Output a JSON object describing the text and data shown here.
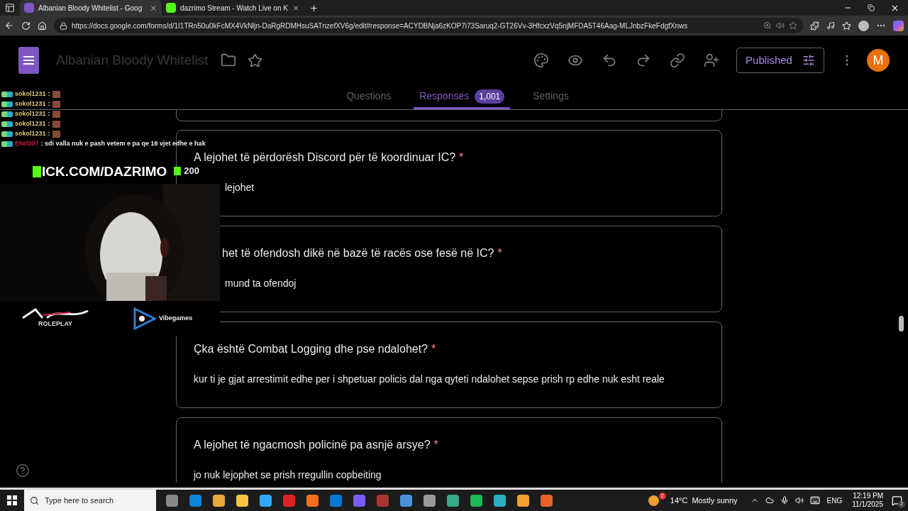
{
  "browser": {
    "tabs": [
      {
        "title": "Albanian Bloody Whitelist - Goog",
        "selected": true,
        "kind": "forms"
      },
      {
        "title": "dazrimo Stream - Watch Live on K",
        "selected": false,
        "kind": "kick"
      }
    ],
    "url": "https://docs.google.com/forms/d/1I1TRn50u0kFcMX4VkNljn-DaRgRDMHsuSATnzefXV6g/edit#response=ACYDBNja6zKOP7i73Saruq2-GT26Vv-3HfcxzVq5njMFDA5T46Aag-MLJnbzFkeFdgfXnws"
  },
  "form": {
    "title": "Albanian Bloody Whitelist",
    "publish_label": "Published",
    "avatar": "M",
    "tabs": [
      {
        "label": "Questions",
        "selected": false
      },
      {
        "label": "Responses",
        "selected": true,
        "badge": "1,001"
      },
      {
        "label": "Settings",
        "selected": false
      }
    ]
  },
  "cards": [
    {
      "question": "A lejohet të përdorësh Discord për të koordinuar IC?",
      "required_mark": "*",
      "answer": "lejohet"
    },
    {
      "question": "het të ofendosh dikë në bazë të racës ose fesë në IC?",
      "required_mark": "*",
      "answer": "mund ta ofendoj"
    },
    {
      "question": "Çka është Combat Logging dhe pse ndalohet?",
      "required_mark": "*",
      "answer": "kur ti je gjat arrestimit edhe per i shpetuar policis dal nga qyteti ndalohet sepse prish rp edhe nuk esht reale"
    },
    {
      "question": "A lejohet të ngacmosh policinë pa asnjë arsye?",
      "required_mark": "*",
      "answer": "jo nuk lejophet se prish rregullin copbeiting"
    }
  ],
  "overlay": {
    "chat": [
      {
        "user": "sokol1231",
        "color": "#d9c77a",
        "text": ":",
        "emote": true
      },
      {
        "user": "sokol1231",
        "color": "#d9c77a",
        "text": ":",
        "emote": true
      },
      {
        "user": "sokol1231",
        "color": "#d9c77a",
        "text": ":",
        "emote": true
      },
      {
        "user": "sokol1231",
        "color": "#d9c77a",
        "text": ":",
        "emote": true
      },
      {
        "user": "sokol1231",
        "color": "#d9c77a",
        "text": ":",
        "emote": true
      },
      {
        "user": "ENISI07",
        "color": "#c8193f",
        "text": ": sdi valla nuk e pash vetem e pa qe 16 vjet edhe e hak",
        "emote": false
      }
    ],
    "channel": "ICK.COM/DAZRIMO",
    "viewers": "200",
    "logo_sub": "ROLEPLAY",
    "partner": "Vibegames"
  },
  "taskbar": {
    "search_placeholder": "Type here to search",
    "weather_badge": "2",
    "temperature": "14°C",
    "condition": "Mostly sunny",
    "language": "ENG",
    "time": "12:19 PM",
    "date": "11/1/2025",
    "notifications": "2"
  }
}
